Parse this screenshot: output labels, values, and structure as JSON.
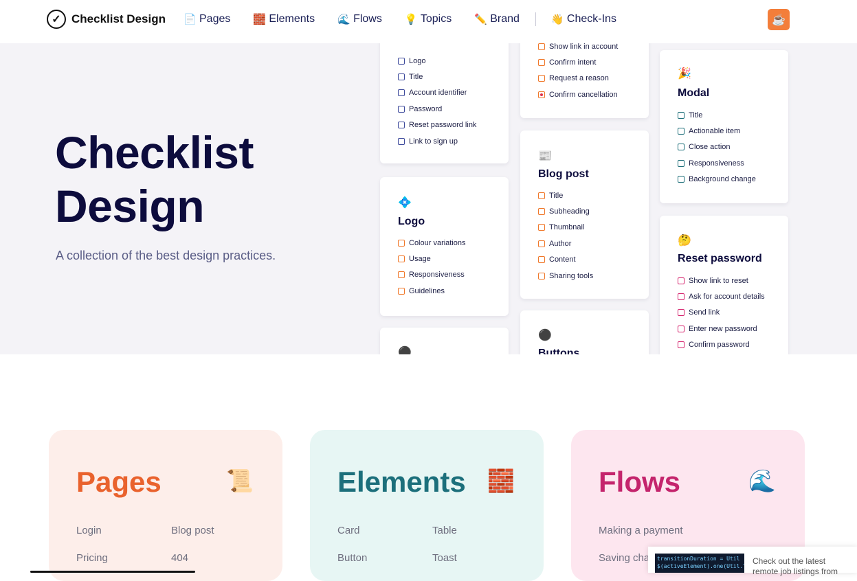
{
  "nav": {
    "brand": "Checklist Design",
    "brand_icon": "check-circle-icon",
    "links": [
      {
        "label": "Pages",
        "icon": "📄"
      },
      {
        "label": "Elements",
        "icon": "🧱"
      },
      {
        "label": "Flows",
        "icon": "🌊"
      },
      {
        "label": "Topics",
        "icon": "💡"
      },
      {
        "label": "Brand",
        "icon": "✏️"
      },
      {
        "label": "Check-Ins",
        "icon": "👋"
      }
    ],
    "coffee_icon": "☕"
  },
  "hero": {
    "title_line1": "Checklist",
    "title_line2": "Design",
    "subtitle": "A collection of the best design practices."
  },
  "cards": {
    "login": {
      "items": [
        "Logo",
        "Title",
        "Account identifier",
        "Password",
        "Reset password link",
        "Link to sign up"
      ]
    },
    "cancel": {
      "items": [
        "Show link in account",
        "Confirm intent",
        "Request a reason",
        "Confirm cancellation"
      ]
    },
    "modal": {
      "emoji": "🎉",
      "title": "Modal",
      "items": [
        "Title",
        "Actionable item",
        "Close action",
        "Responsiveness",
        "Background change"
      ]
    },
    "logo": {
      "emoji": "💠",
      "title": "Logo",
      "items": [
        "Colour variations",
        "Usage",
        "Responsiveness",
        "Guidelines"
      ]
    },
    "blog": {
      "emoji": "📰",
      "title": "Blog post",
      "items": [
        "Title",
        "Subheading",
        "Thumbnail",
        "Author",
        "Content",
        "Sharing tools"
      ]
    },
    "reset": {
      "emoji": "🤔",
      "title": "Reset password",
      "items": [
        "Show link to reset",
        "Ask for account details",
        "Send link",
        "Enter new password",
        "Confirm password"
      ]
    },
    "buttons": {
      "emoji": "⚫",
      "title": "Buttons"
    },
    "partial_emoji": "⚫"
  },
  "sections": {
    "pages": {
      "title": "Pages",
      "icon": "📜",
      "links": [
        "Login",
        "Blog post",
        "Pricing",
        "404"
      ]
    },
    "elements": {
      "title": "Elements",
      "icon": "🧱",
      "links": [
        "Card",
        "Table",
        "Button",
        "Toast"
      ]
    },
    "flows": {
      "title": "Flows",
      "icon": "🌊",
      "links": [
        "Making a payment",
        "Saving cha"
      ]
    }
  },
  "ad": {
    "code": "transitionDuration = Util\n$(activeElement).one(Util.T",
    "text": "Check out the latest remote job listings from"
  }
}
